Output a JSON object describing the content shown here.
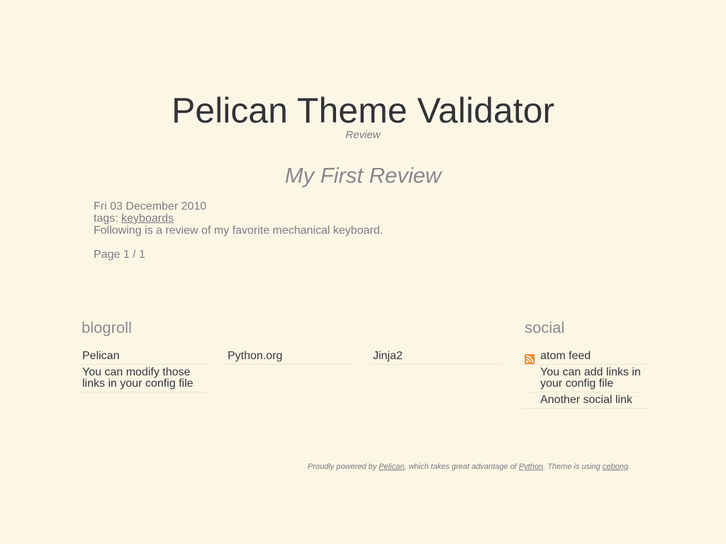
{
  "header": {
    "site_title": "Pelican Theme Validator",
    "category": "Review"
  },
  "article": {
    "title": "My First Review",
    "date": "Fri 03 December 2010",
    "tags_label": "tags:",
    "tag": "keyboards",
    "summary": "Following is a review of my favorite mechanical keyboard.",
    "pagination": "Page 1 / 1"
  },
  "blogroll": {
    "heading": "blogroll",
    "columns": [
      [
        "Pelican",
        "You can modify those links in your config file"
      ],
      [
        "Python.org"
      ],
      [
        "Jinja2"
      ]
    ]
  },
  "social": {
    "heading": "social",
    "items": [
      {
        "label": "atom feed",
        "icon": "rss-icon"
      },
      {
        "label": "You can add links in your config file"
      },
      {
        "label": "Another social link"
      }
    ]
  },
  "footer": {
    "text_1": "Proudly powered by ",
    "link_pelican": "Pelican",
    "text_2": ", which takes great advantage of ",
    "link_python": "Python",
    "text_3": ". Theme is using ",
    "link_theme": "cebong",
    "text_4": "."
  },
  "colors": {
    "background": "#fcf6e4",
    "text": "#333333",
    "muted": "#7a7a7a",
    "rss": "#f08a24"
  }
}
